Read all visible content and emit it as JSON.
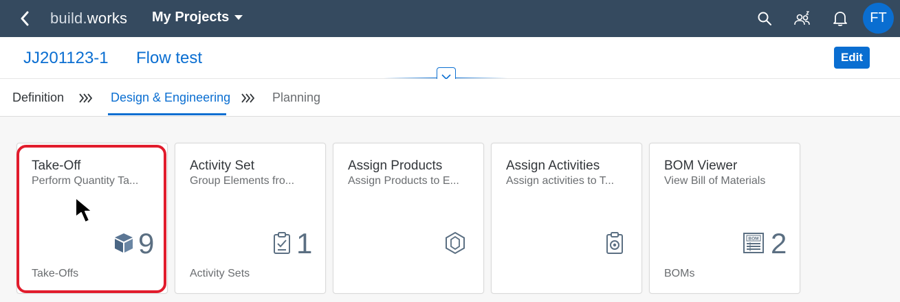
{
  "shell": {
    "brand_prefix": "build.",
    "brand_suffix": "works",
    "projects_menu": "My Projects",
    "avatar_initials": "FT",
    "colors": {
      "bar": "#354a5f",
      "accent": "#0a6ed1"
    }
  },
  "header": {
    "object_id": "JJ201123-1",
    "object_name": "Flow test",
    "edit_label": "Edit"
  },
  "tabs": [
    {
      "label": "Definition",
      "state": "normal"
    },
    {
      "label": "Design & Engineering",
      "state": "active"
    },
    {
      "label": "Planning",
      "state": "muted"
    }
  ],
  "tab_separator": "»",
  "tiles": [
    {
      "title": "Take-Off",
      "subtitle": "Perform Quantity Ta...",
      "kpi": "9",
      "footer": "Take-Offs",
      "icon": "cube-icon",
      "highlighted": true
    },
    {
      "title": "Activity Set",
      "subtitle": "Group Elements fro...",
      "kpi": "1",
      "footer": "Activity Sets",
      "icon": "clipboard-check-icon"
    },
    {
      "title": "Assign Products",
      "subtitle": "Assign Products to E...",
      "kpi": "",
      "footer": "",
      "icon": "product-hexagon-icon"
    },
    {
      "title": "Assign Activities",
      "subtitle": "Assign activities to T...",
      "kpi": "",
      "footer": "",
      "icon": "activity-target-icon"
    },
    {
      "title": "BOM Viewer",
      "subtitle": "View Bill of Materials",
      "kpi": "2",
      "footer": "BOMs",
      "icon": "bom-icon",
      "icon_text": "BOM"
    }
  ]
}
